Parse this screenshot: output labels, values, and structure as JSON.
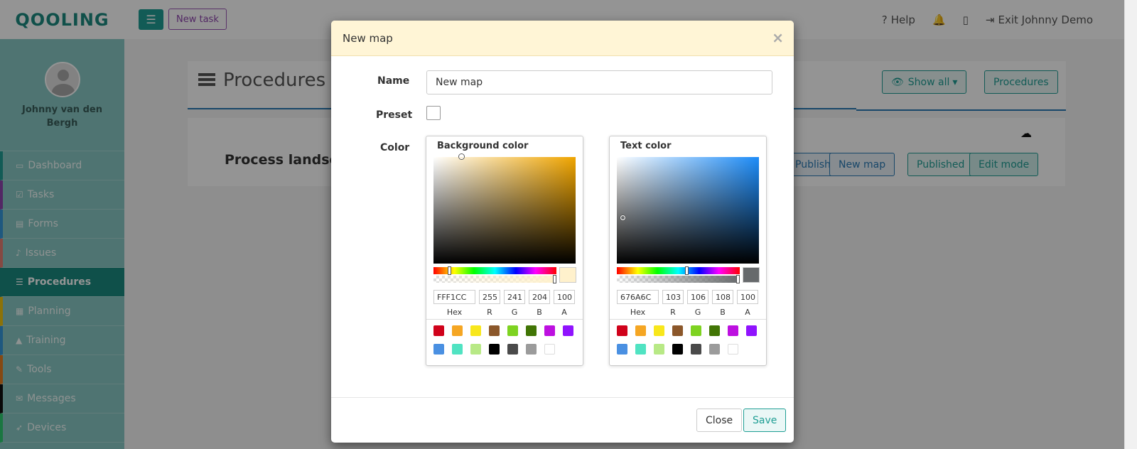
{
  "topbar": {
    "logo": "QOOLING",
    "new_task": "New task",
    "help": "Help",
    "exit": "Exit Johnny Demo"
  },
  "sidebar": {
    "username": "Johnny van den Bergh",
    "items": [
      {
        "label": "Dashboard",
        "icon": "monitor-icon",
        "accent": "#1f9e94"
      },
      {
        "label": "Tasks",
        "icon": "checkbox-icon",
        "accent": "#8e44ad"
      },
      {
        "label": "Forms",
        "icon": "document-icon",
        "accent": "#3498db"
      },
      {
        "label": "Issues",
        "icon": "bell-icon",
        "accent": "#e67e73"
      },
      {
        "label": "Procedures",
        "icon": "list-icon",
        "accent": "#1a8a80"
      },
      {
        "label": "Planning",
        "icon": "calendar-icon",
        "accent": "#f1c40f"
      },
      {
        "label": "Training",
        "icon": "graduation-cap-icon",
        "accent": "#3498db"
      },
      {
        "label": "Tools",
        "icon": "wrench-icon",
        "accent": "#e67e22"
      },
      {
        "label": "Messages",
        "icon": "envelope-icon",
        "accent": "#111111"
      },
      {
        "label": "Devices",
        "icon": "rocket-icon",
        "accent": "#2ecc71"
      }
    ]
  },
  "main": {
    "title": "Procedures",
    "show_all": "Show all",
    "procedures_btn": "Procedures",
    "landscape_title": "Process landscape",
    "publish": "Publish",
    "new_map": "New map",
    "published": "Published",
    "edit_mode": "Edit mode"
  },
  "modal": {
    "title": "New map",
    "name_label": "Name",
    "name_value": "New map",
    "preset_label": "Preset",
    "color_label": "Color",
    "close": "Close",
    "save": "Save",
    "labels": {
      "hex": "Hex",
      "r": "R",
      "g": "G",
      "b": "B",
      "a": "A"
    },
    "background": {
      "title": "Background color",
      "hex": "FFF1CC",
      "r": "255",
      "g": "241",
      "b": "204",
      "a": "100",
      "swatch_color": "#FFF1CC",
      "hue_color": "#f0a500"
    },
    "text": {
      "title": "Text color",
      "hex": "676A6C",
      "r": "103",
      "g": "106",
      "b": "108",
      "a": "100",
      "swatch_color": "#676A6C",
      "hue_color": "#1d8cf8"
    },
    "presets": [
      "#d0021b",
      "#f5a623",
      "#f8e71c",
      "#8b572a",
      "#7ed321",
      "#417505",
      "#bd10e0",
      "#9013fe",
      "#4a90e2",
      "#50e3c2",
      "#b8e986",
      "#000000",
      "#4a4a4a",
      "#9b9b9b",
      "#ffffff"
    ]
  }
}
